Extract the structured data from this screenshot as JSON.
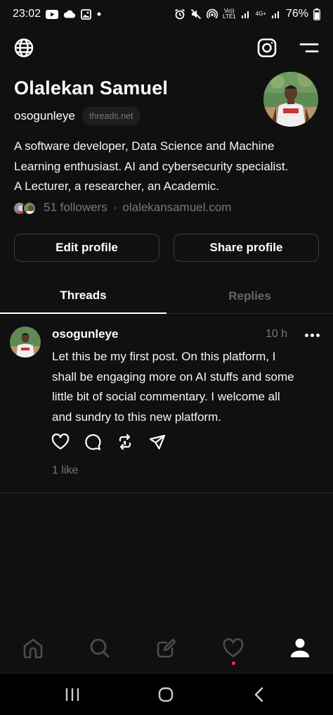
{
  "status_bar": {
    "time": "23:02",
    "battery": "76%",
    "volte_line1": "Vo))",
    "volte_line2": "LTE1",
    "network_4g": "4G+"
  },
  "profile": {
    "name": "Olalekan Samuel",
    "handle": "osogunleye",
    "domain_chip": "threads.net",
    "bio_lines": [
      "A software developer, Data Science and Machine",
      "Learning enthusiast. AI and cybersecurity specialist.",
      "A Lecturer, a researcher, an Academic."
    ],
    "followers": "51 followers",
    "separator": "·",
    "website": "olalekansamuel.com"
  },
  "buttons": {
    "edit": "Edit profile",
    "share": "Share profile"
  },
  "tabs": [
    {
      "label": "Threads",
      "active": true
    },
    {
      "label": "Replies",
      "active": false
    }
  ],
  "post": {
    "username": "osogunleye",
    "time": "10 h",
    "text_lines": [
      "Let this be my first post. On this platform, I",
      "shall be engaging more on AI stuffs and some",
      "little bit of social commentary. I welcome all",
      "and sundry to this new platform."
    ],
    "likes": "1 like"
  },
  "icons": {
    "top": [
      "globe-icon",
      "instagram-icon",
      "menu-icon"
    ],
    "post_actions": [
      "heart-icon",
      "comment-icon",
      "repost-icon",
      "share-icon"
    ],
    "bottom_nav": [
      "home-icon",
      "search-icon",
      "compose-icon",
      "activity-icon",
      "profile-icon"
    ],
    "android_nav": [
      "recents-icon",
      "home-circle-icon",
      "back-icon"
    ]
  },
  "colors": {
    "background": "#101010",
    "text": "#f3f5f7",
    "muted": "#777777",
    "notification_dot": "#ff3040"
  }
}
